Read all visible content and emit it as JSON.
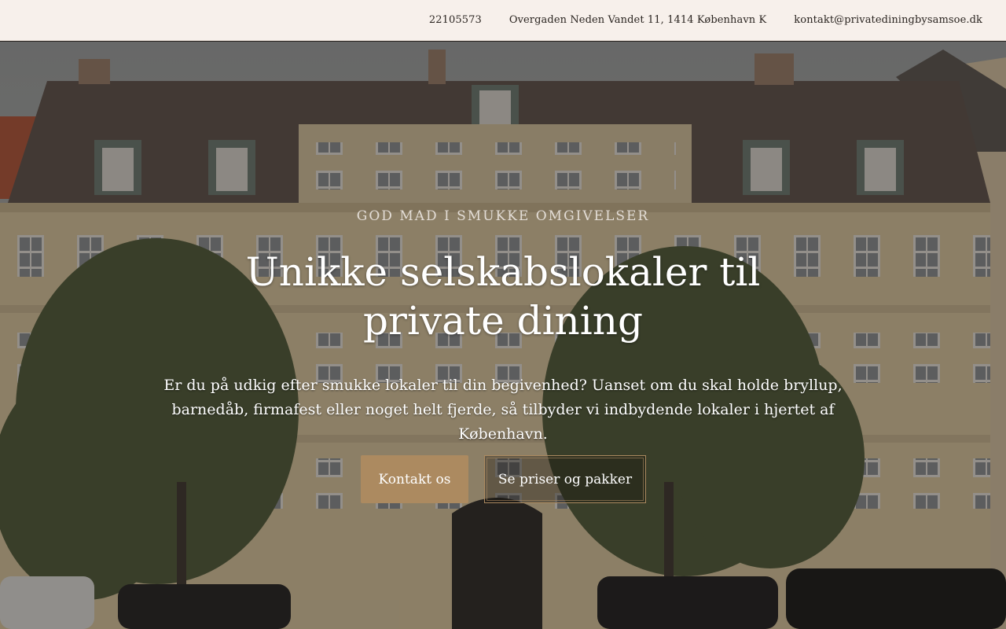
{
  "topbar": {
    "phone": "22105573",
    "address": "Overgaden Neden Vandet 11, 1414 København K",
    "email": "kontakt@privatediningbysamsoe.dk"
  },
  "hero": {
    "eyebrow": "GOD MAD I SMUKKE OMGIVELSER",
    "title": "Unikke selskabslokaler til private dining",
    "lead": "Er du på udkig efter smukke lokaler til din begivenhed? Uanset om du skal holde bryllup, barnedåb, firmafest eller noget helt fjerde, så tilbyder vi indbydende lokaler i hjertet af København.",
    "primary_button": "Kontakt os",
    "secondary_button": "Se priser og pakker",
    "background_image": "building-facade-photo"
  },
  "colors": {
    "topbar_bg": "#f7f0eb",
    "accent": "#ac8a60"
  }
}
